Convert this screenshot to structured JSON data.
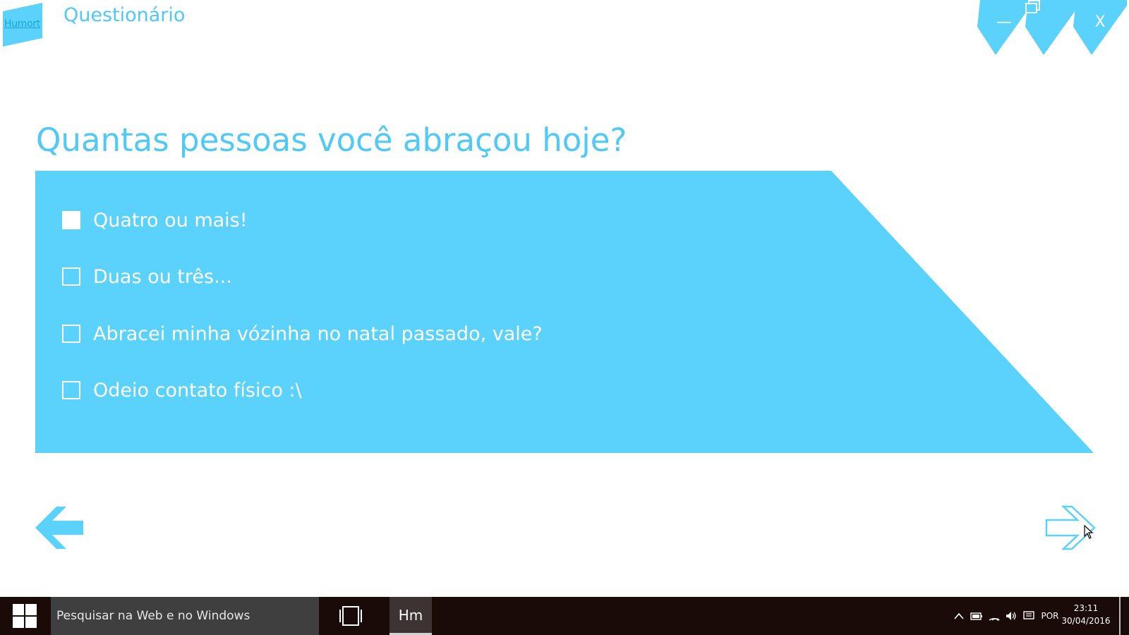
{
  "app": {
    "logo_text": "Humort",
    "title": "Questionário",
    "accent": "#5bd2fb",
    "accent_text": "#4fc9f7",
    "window_controls": {
      "minimize": "—",
      "restore_icon": "restore-icon",
      "close": "X"
    }
  },
  "question": {
    "text": "Quantas pessoas você abraçou hoje?",
    "options": [
      {
        "label": "Quatro ou mais!",
        "checked": true
      },
      {
        "label": "Duas ou três...",
        "checked": false
      },
      {
        "label": "Abracei minha vózinha no natal passado, vale?",
        "checked": false
      },
      {
        "label": "Odeio contato físico :\\",
        "checked": false
      }
    ]
  },
  "navigation": {
    "back_icon": "arrow-left-icon",
    "next_icon": "arrow-right-outline-icon"
  },
  "taskbar": {
    "search_placeholder": "Pesquisar na Web e no Windows",
    "app_label": "Hm",
    "language": "POR",
    "time": "23:11",
    "date": "30/04/2016"
  }
}
